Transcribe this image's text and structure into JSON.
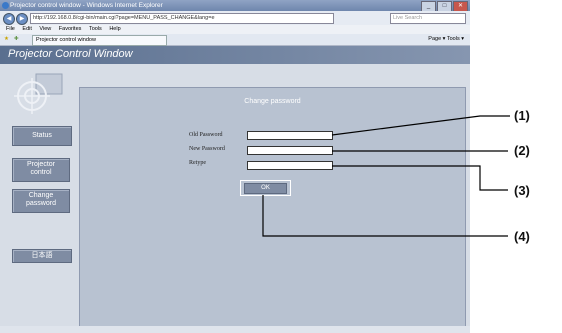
{
  "window": {
    "title": "Projector control window - Windows Internet Explorer",
    "buttons": [
      "_",
      "□",
      "✕"
    ]
  },
  "address_bar": {
    "url": "http://192.168.0.8/cgi-bin/main.cgi?page=MENU_PASS_CHANGE&lang=e",
    "search_placeholder": "Live Search"
  },
  "menu": [
    "File",
    "Edit",
    "View",
    "Favorites",
    "Tools",
    "Help"
  ],
  "tab": {
    "label": "Projector control window"
  },
  "toolbar": {
    "tools": "Page ▾   Tools ▾"
  },
  "app": {
    "banner_title": "Projector Control Window"
  },
  "sidebar": [
    {
      "label": "Status"
    },
    {
      "label": "Projector control"
    },
    {
      "label": "Change password"
    },
    {
      "label": "日本語"
    }
  ],
  "form": {
    "title": "Change password",
    "old_password_label": "Old Password",
    "new_password_label": "New Password",
    "retype_label": "Retype",
    "ok_label": "OK"
  },
  "callouts": [
    "(1)",
    "(2)",
    "(3)",
    "(4)"
  ]
}
